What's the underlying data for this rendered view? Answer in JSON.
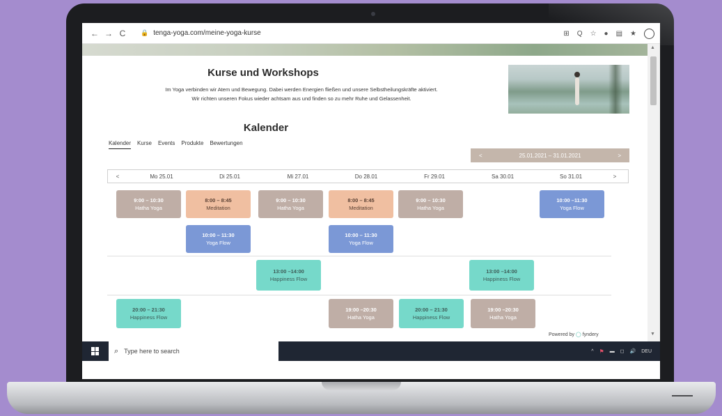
{
  "browser": {
    "url": "tenga-yoga.com/meine-yoga-kurse",
    "nav": {
      "back": "←",
      "forward": "→",
      "reload": "C"
    },
    "lock": "🔒",
    "tools": [
      "⊞",
      "Q",
      "☆",
      "●",
      "▤",
      "★"
    ]
  },
  "page": {
    "title": "Kurse und Workshops",
    "intro_line1": "Im Yoga verbinden wir Atem und Bewegung. Dabei werden Energien fließen und unsere Selbstheilungskräfte aktiviert.",
    "intro_line2": "Wir richten unseren Fokus wieder achtsam aus und finden so zu mehr Ruhe und Gelassenheit.",
    "subtitle": "Kalender"
  },
  "tabs": [
    "Kalender",
    "Kurse",
    "Events",
    "Produkte",
    "Bewertungen"
  ],
  "week": {
    "prev": "<",
    "range": "25.01.2021 – 31.01.2021",
    "next": ">"
  },
  "days": {
    "prev": "<",
    "next": ">",
    "labels": [
      "Mo 25.01",
      "Di 25.01",
      "Mi 27.01",
      "Do 28.01",
      "Fr 29.01",
      "Sa 30.01",
      "So 31.01"
    ]
  },
  "events": [
    {
      "time": "9:00 – 10:30",
      "name": "Hatha Yoga",
      "color": "#bfaea6"
    },
    {
      "time": "8:00 – 8:45",
      "name": "Meditation",
      "color": "#f0bfa1"
    },
    {
      "time": "9:00 – 10:30",
      "name": "Hatha Yoga",
      "color": "#bfaea6"
    },
    {
      "time": "8:00 – 8:45",
      "name": "Meditation",
      "color": "#f0bfa1"
    },
    {
      "time": "9:00 – 10:30",
      "name": "Hatha Yoga",
      "color": "#bfaea6"
    },
    {
      "time": "10:00 –11:30",
      "name": "Yoga Flow",
      "color": "#7b98d6"
    },
    {
      "time": "10:00 – 11:30",
      "name": "Yoga Flow",
      "color": "#7b98d6"
    },
    {
      "time": "10:00 – 11:30",
      "name": "Yoga Flow",
      "color": "#7b98d6"
    },
    {
      "time": "13:00 –14:00",
      "name": "Happiness Flow",
      "color": "#76d9ca"
    },
    {
      "time": "13:00 –14:00",
      "name": "Happiness Flow",
      "color": "#76d9ca"
    },
    {
      "time": "20:00 – 21:30",
      "name": "Happiness Flow",
      "color": "#76d9ca"
    },
    {
      "time": "19:00 –20:30",
      "name": "Hatha Yoga",
      "color": "#bfaea6"
    },
    {
      "time": "20:00 – 21:30",
      "name": "Happiness Flow",
      "color": "#76d9ca"
    },
    {
      "time": "19:00 –20:30",
      "name": "Hatha Yoga",
      "color": "#bfaea6"
    }
  ],
  "powered": {
    "prefix": "Powered by",
    "brand": "fyndery",
    "dot": "◯"
  },
  "taskbar": {
    "search_placeholder": "Type here to search",
    "search_icon": "⌕",
    "tray": [
      "^",
      "⚑",
      "▬",
      "◻",
      "🔊",
      "DEU"
    ]
  }
}
